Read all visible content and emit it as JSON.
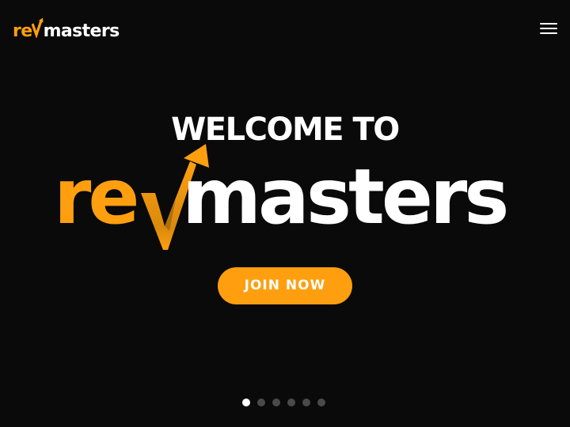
{
  "header": {
    "logo": {
      "part1": "re",
      "part2": "masters"
    },
    "menu_icon": "hamburger-menu-icon"
  },
  "hero": {
    "welcome": "WELCOME TO",
    "logo": {
      "part1": "re",
      "part2": "masters"
    },
    "join_label": "JOIN NOW"
  },
  "carousel": {
    "slide_count": 6,
    "active_index": 0
  },
  "colors": {
    "background": "#0a0a0b",
    "accent": "#ff9f0f",
    "text": "#ffffff",
    "dot_inactive": "#4a4a4a"
  }
}
